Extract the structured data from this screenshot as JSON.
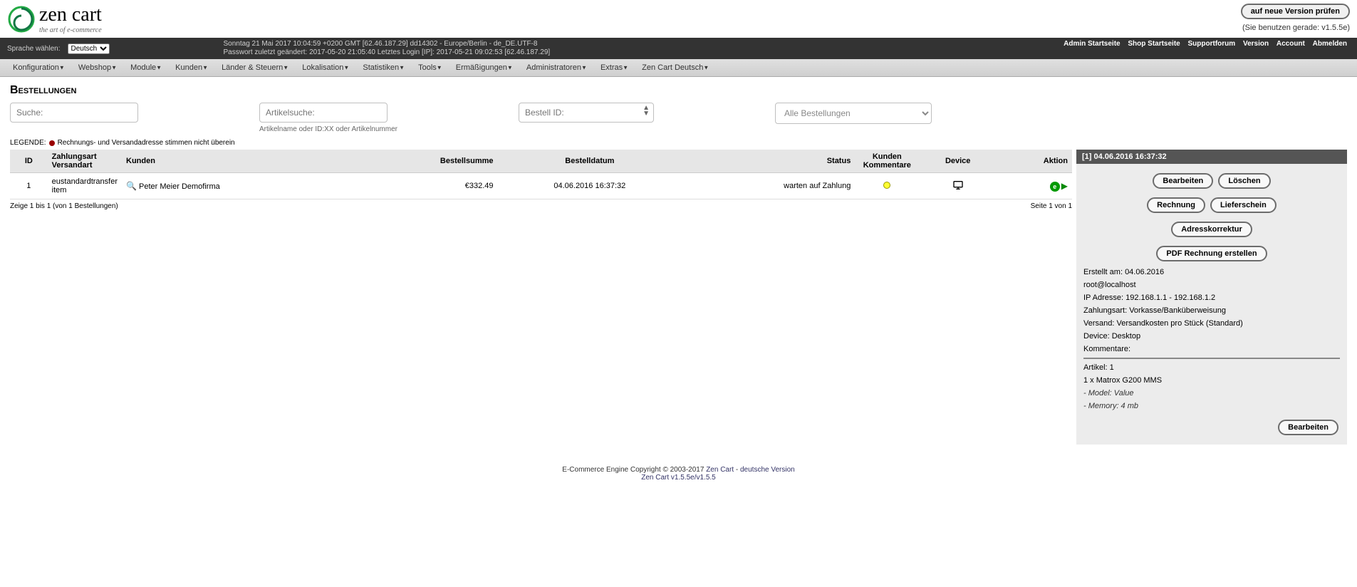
{
  "header": {
    "logo_main": "zen cart",
    "logo_sub": "the art of e-commerce",
    "version_check_btn": "auf neue Version prüfen",
    "version_using": "(Sie benutzen gerade: v1.5.5e)"
  },
  "statusbar": {
    "lang_label": "Sprache wählen:",
    "lang_value": "Deutsch",
    "line1": "Sonntag 21 Mai 2017 10:04:59 +0200 GMT [62.46.187.29]  dd14302 - Europe/Berlin - de_DE.UTF-8",
    "line2": "Passwort zuletzt geändert: 2017-05-20 21:05:40   Letztes Login [IP]: 2017-05-21 09:02:53 [62.46.187.29]",
    "links": [
      "Admin Startseite",
      "Shop Startseite",
      "Supportforum",
      "Version",
      "Account",
      "Abmelden"
    ]
  },
  "menu": [
    "Konfiguration",
    "Webshop",
    "Module",
    "Kunden",
    "Länder & Steuern",
    "Lokalisation",
    "Statistiken",
    "Tools",
    "Ermäßigungen",
    "Administratoren",
    "Extras",
    "Zen Cart Deutsch"
  ],
  "page_title": "Bestellungen",
  "filters": {
    "search_ph": "Suche:",
    "article_ph": "Artikelsuche:",
    "article_help": "Artikelname oder ID:XX oder Artikelnummer",
    "orderid_ph": "Bestell ID:",
    "status_selected": "Alle Bestellungen"
  },
  "legend": {
    "label": "LEGENDE:",
    "text": "Rechnungs- und Versandadresse stimmen nicht überein"
  },
  "table": {
    "headers": {
      "id": "ID",
      "payment": "Zahlungsart Versandart",
      "customers": "Kunden",
      "total": "Bestellsumme",
      "date": "Bestelldatum",
      "status": "Status",
      "comments": "Kunden Kommentare",
      "device": "Device",
      "action": "Aktion"
    },
    "rows": [
      {
        "id": "1",
        "payment": "eustandardtransfer item",
        "customer": "Peter Meier Demofirma",
        "total": "€332.49",
        "date": "04.06.2016 16:37:32",
        "status": "warten auf Zahlung"
      }
    ]
  },
  "pager": {
    "left": "Zeige 1 bis 1 (von 1 Bestellungen)",
    "right": "Seite 1 von 1"
  },
  "sidebar": {
    "header": "[1]  04.06.2016 16:37:32",
    "buttons": {
      "edit": "Bearbeiten",
      "delete": "Löschen",
      "invoice": "Rechnung",
      "packingslip": "Lieferschein",
      "address": "Adresskorrektur",
      "pdf": "PDF Rechnung erstellen"
    },
    "created": "Erstellt am: 04.06.2016",
    "email": "root@localhost",
    "ip": "IP Adresse: 192.168.1.1 - 192.168.1.2",
    "payment": "Zahlungsart: Vorkasse/Banküberweisung",
    "shipping": "Versand: Versandkosten pro Stück (Standard)",
    "device": "Device: Desktop",
    "comments": "Kommentare:",
    "articles_head": "Artikel: 1",
    "article_line": "1 x Matrox G200 MMS",
    "attr1": "- Model: Value",
    "attr2": "- Memory: 4 mb",
    "edit2": "Bearbeiten"
  },
  "footer": {
    "line1a": "E-Commerce Engine Copyright © 2003-2017 ",
    "line1b": "Zen Cart",
    "line1c": " - ",
    "line1d": "deutsche Version",
    "line2": "Zen Cart v1.5.5e/v1.5.5"
  }
}
